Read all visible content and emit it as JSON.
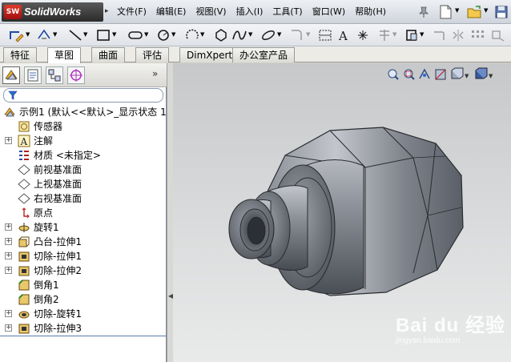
{
  "app": {
    "logo_badge": "SW",
    "logo_text": "SolidWorks"
  },
  "menu": [
    "文件(F)",
    "编辑(E)",
    "视图(V)",
    "插入(I)",
    "工具(T)",
    "窗口(W)",
    "帮助(H)"
  ],
  "tabs": [
    {
      "label": "特征",
      "active": false
    },
    {
      "label": "草图",
      "active": true
    },
    {
      "label": "曲面",
      "active": false
    },
    {
      "label": "评估",
      "active": false
    },
    {
      "label": "DimXpert",
      "active": false
    },
    {
      "label": "办公室产品",
      "active": false
    }
  ],
  "tree": {
    "root": "示例1   (默认<<默认>_显示状态 1>)",
    "items": [
      {
        "label": "传感器",
        "icon": "sensor-icon",
        "expandable": false
      },
      {
        "label": "注解",
        "icon": "annotation-icon",
        "expandable": true
      },
      {
        "label": "材质 <未指定>",
        "icon": "material-icon",
        "expandable": false
      },
      {
        "label": "前视基准面",
        "icon": "plane-icon",
        "expandable": false
      },
      {
        "label": "上视基准面",
        "icon": "plane-icon",
        "expandable": false
      },
      {
        "label": "右视基准面",
        "icon": "plane-icon",
        "expandable": false
      },
      {
        "label": "原点",
        "icon": "origin-icon",
        "expandable": false
      },
      {
        "label": "旋转1",
        "icon": "revolve-icon",
        "expandable": true
      },
      {
        "label": "凸台-拉伸1",
        "icon": "boss-extrude-icon",
        "expandable": true
      },
      {
        "label": "切除-拉伸1",
        "icon": "cut-extrude-icon",
        "expandable": true
      },
      {
        "label": "切除-拉伸2",
        "icon": "cut-extrude-icon",
        "expandable": true
      },
      {
        "label": "倒角1",
        "icon": "chamfer-icon",
        "expandable": false
      },
      {
        "label": "倒角2",
        "icon": "chamfer-icon",
        "expandable": false
      },
      {
        "label": "切除-旋转1",
        "icon": "cut-revolve-icon",
        "expandable": true
      },
      {
        "label": "切除-拉伸3",
        "icon": "cut-extrude-icon",
        "expandable": true
      }
    ]
  },
  "watermark": {
    "brand": "Bai du 经验",
    "url": "jingyan.baidu.com"
  },
  "colors": {
    "viewport_top": "#c6c8ca",
    "viewport_bottom": "#e9eaea",
    "part_dark": "#3e4147",
    "part_mid": "#7b7f88",
    "part_light": "#b9bcc3",
    "accent_red": "#cc2a1c"
  }
}
